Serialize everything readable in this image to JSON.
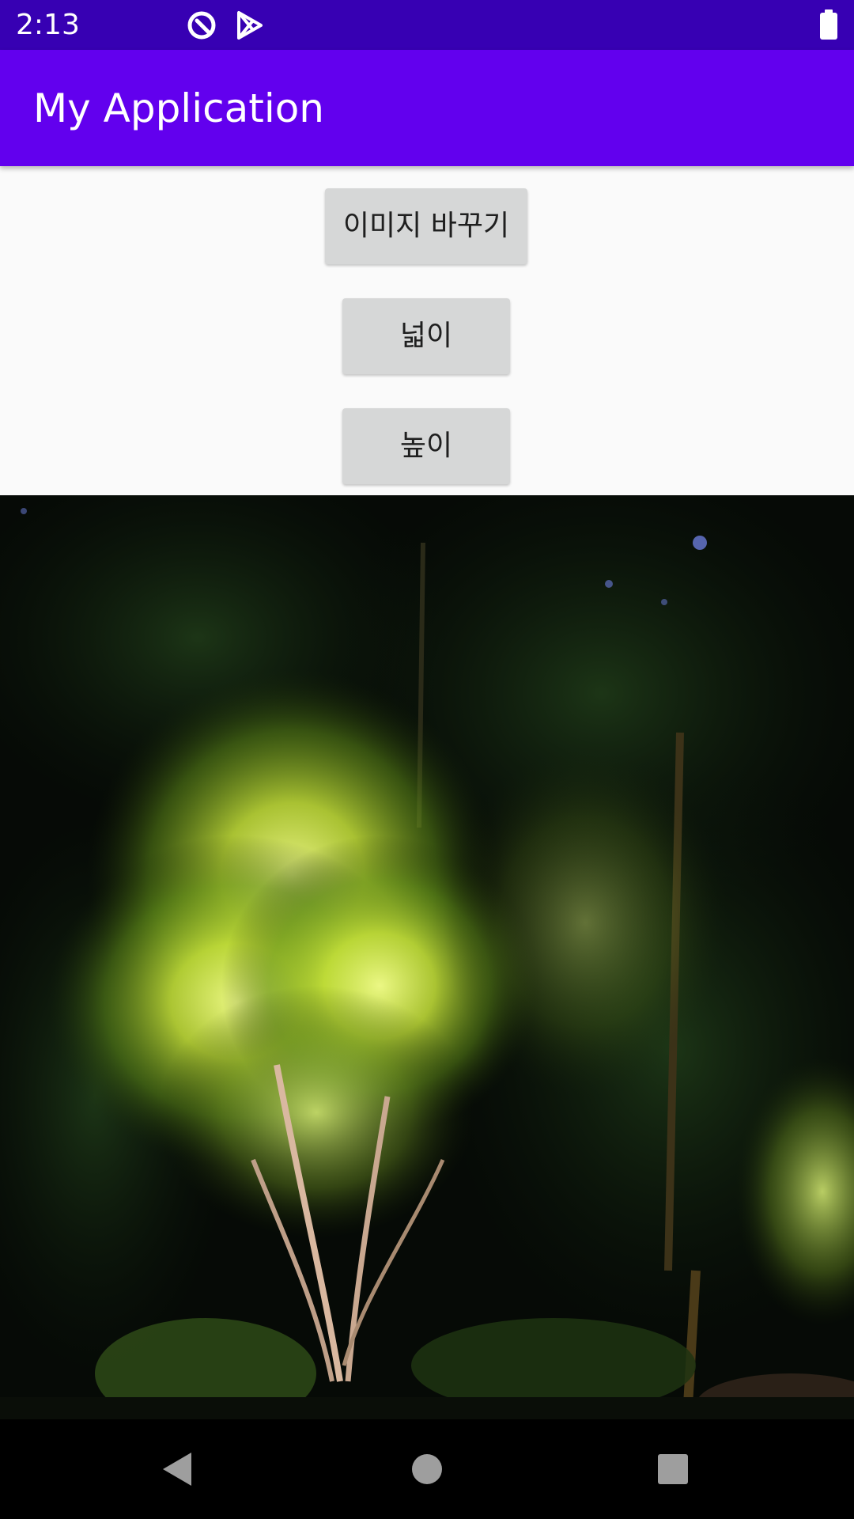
{
  "status_bar": {
    "time": "2:13",
    "icons": [
      "data-saver-icon",
      "play-store-icon",
      "battery-icon"
    ],
    "background": "#3700b3"
  },
  "app_bar": {
    "title": "My Application",
    "background": "#6200ee"
  },
  "buttons": {
    "change_image": "이미지 바꾸기",
    "width": "넓이",
    "height": "높이"
  },
  "image": {
    "subject": "night-lit-tree-photo"
  },
  "nav_bar": {
    "icons": [
      "back-icon",
      "home-icon",
      "recents-icon"
    ]
  }
}
